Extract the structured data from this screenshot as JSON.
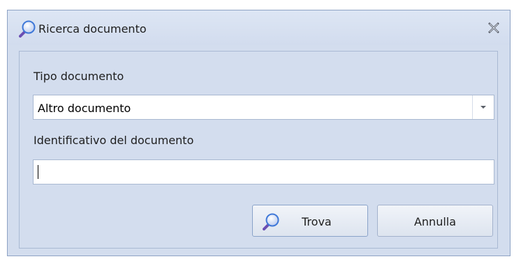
{
  "window": {
    "title": "Ricerca documento",
    "title_icon": "search-icon",
    "close_icon": "close-icon"
  },
  "form": {
    "tipo_label": "Tipo documento",
    "tipo_value": "Altro documento",
    "identificativo_label": "Identificativo del documento",
    "identificativo_value": ""
  },
  "buttons": {
    "search_label": "Trova",
    "search_icon": "search-icon",
    "cancel_label": "Annulla"
  },
  "colors": {
    "window_background": "#d3ddee",
    "border": "#8da2c4",
    "icon_accent": "#7b5fc0"
  }
}
